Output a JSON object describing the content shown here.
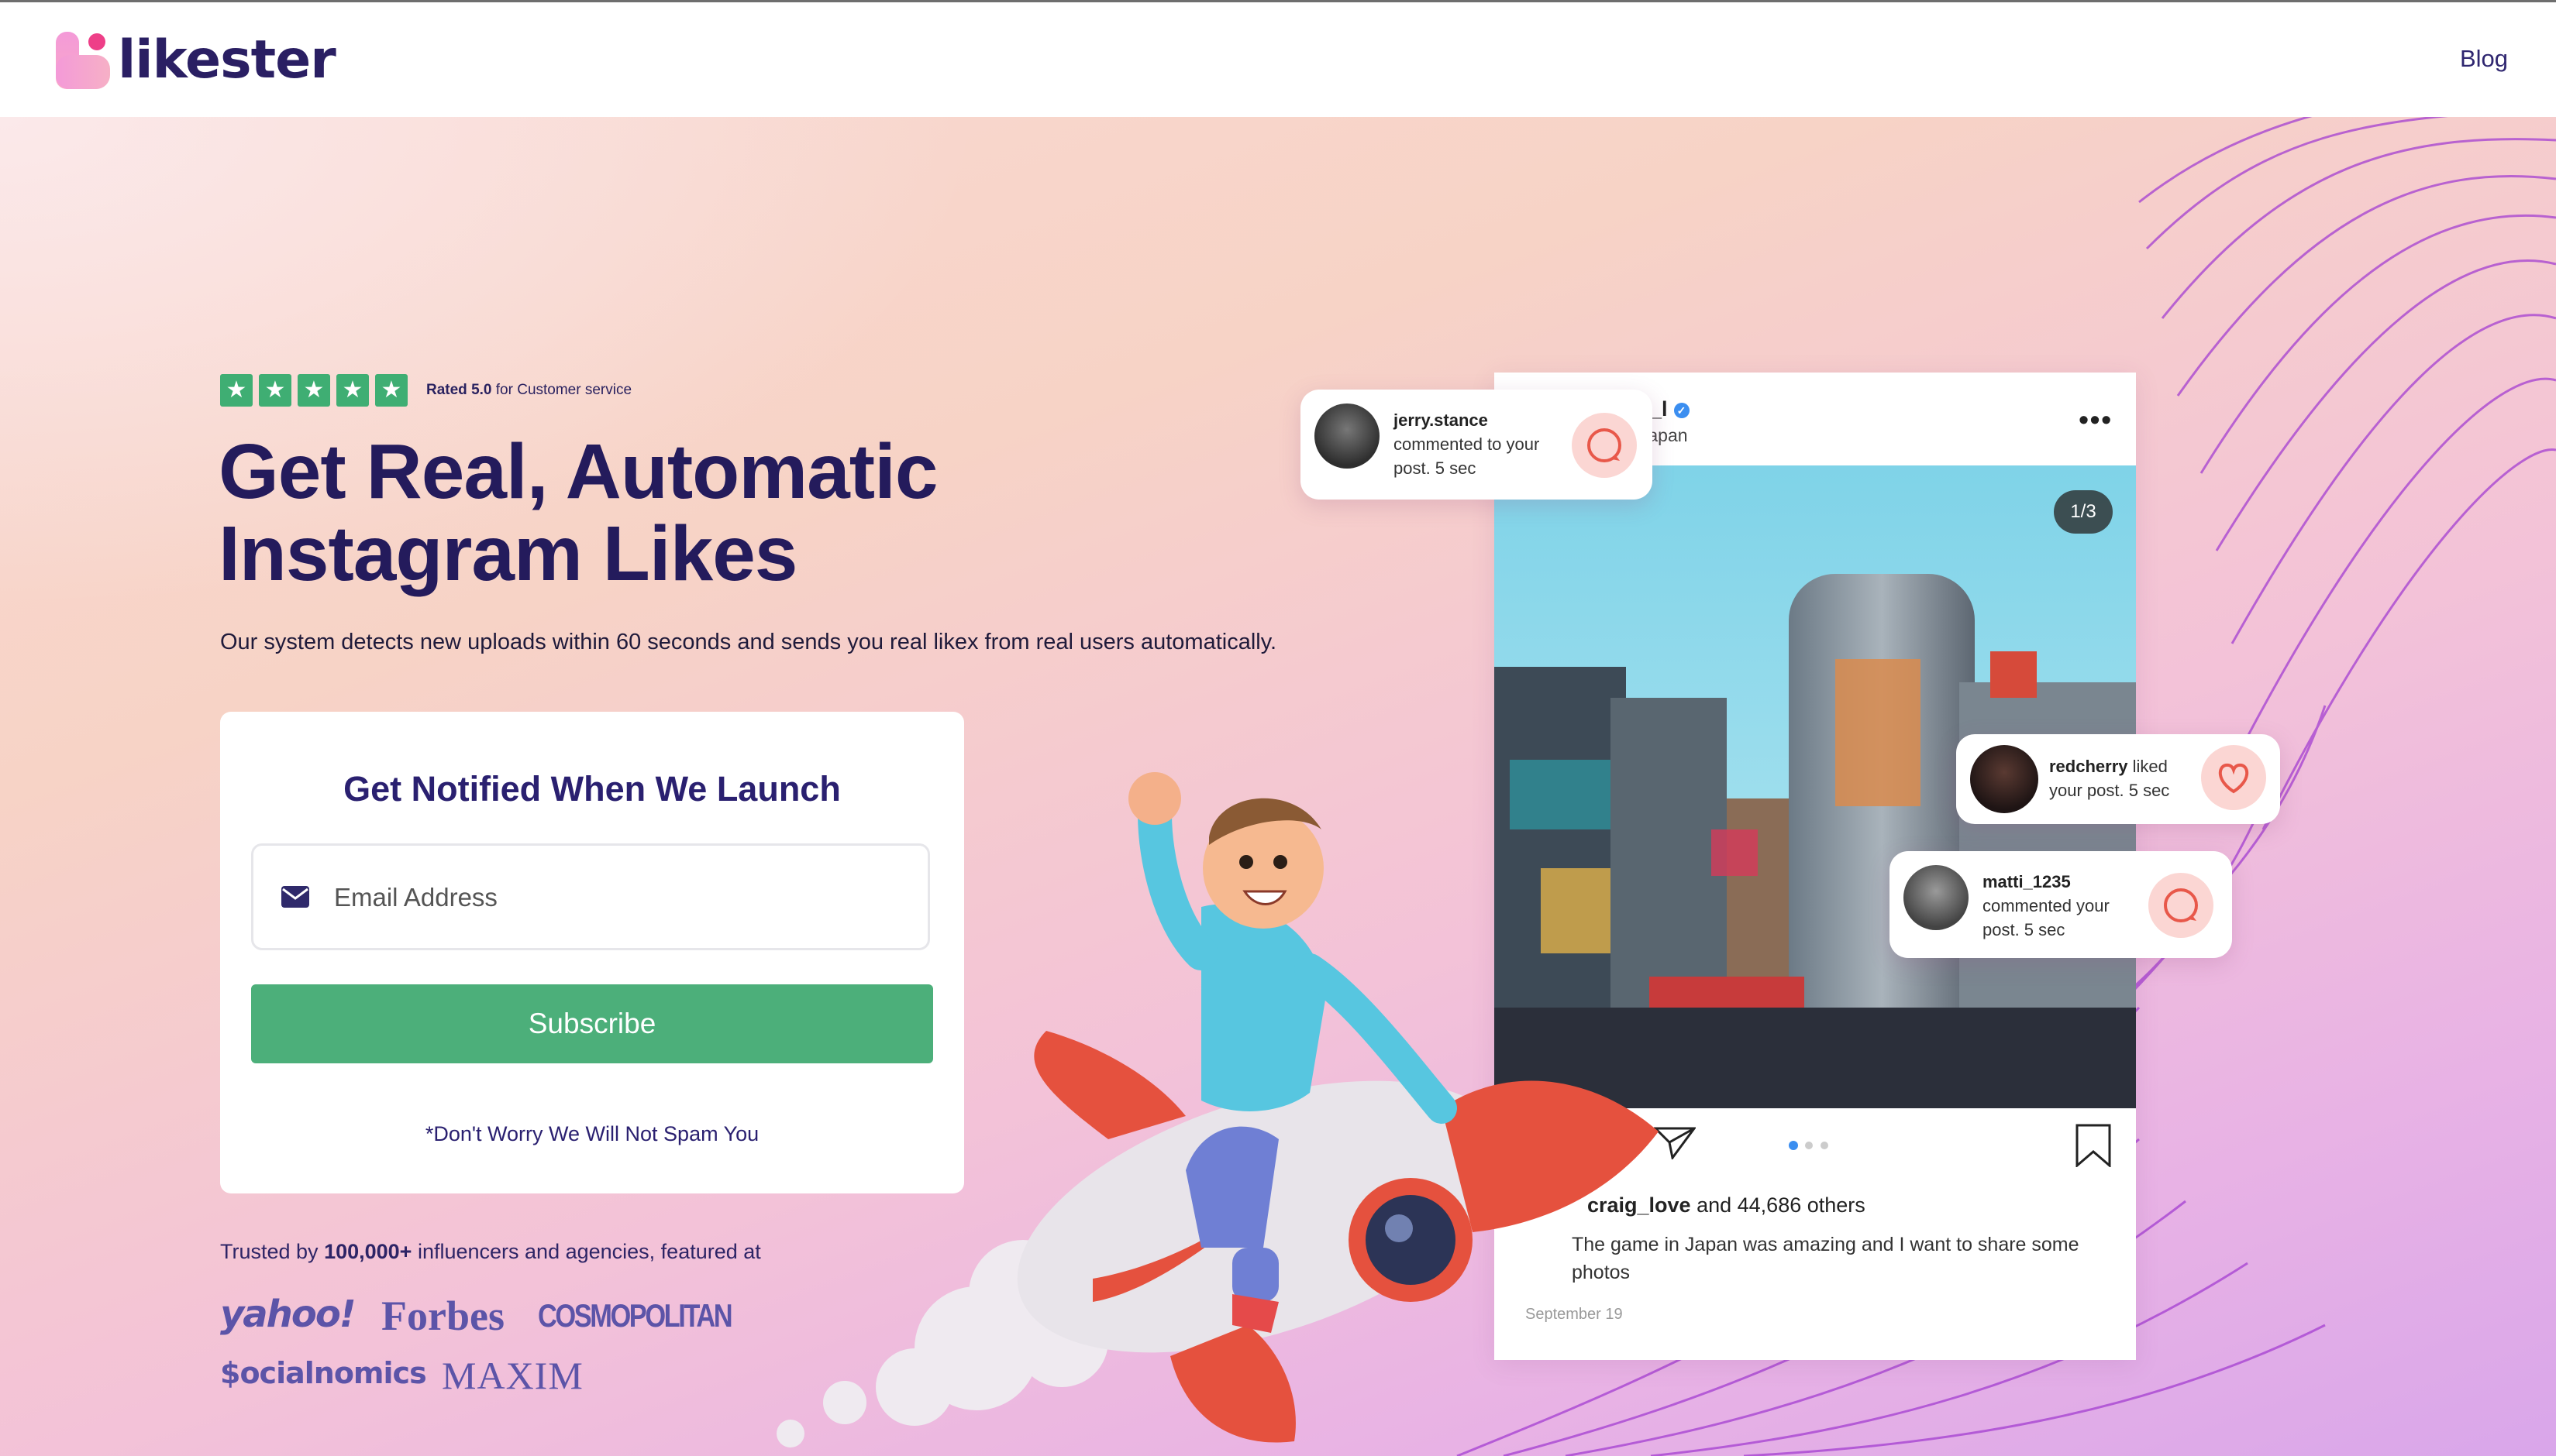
{
  "brand": {
    "name": "likester",
    "accent": "#4caf7a",
    "primary_text": "#241b5c"
  },
  "nav": {
    "blog_label": "Blog"
  },
  "rating": {
    "stars": 5,
    "rated_label": "Rated 5.0",
    "suffix": "for Customer service"
  },
  "hero": {
    "headline_line1": "Get Real, Automatic",
    "headline_line2": "Instagram Likes",
    "subtext": "Our system detects new uploads within 60 seconds and sends you real likex from real users automatically."
  },
  "signup": {
    "title": "Get Notified When We Launch",
    "email_placeholder": "Email Address",
    "email_value": "",
    "subscribe_label": "Subscribe",
    "disclaimer": "*Don't Worry We Will Not Spam You"
  },
  "trust": {
    "prefix": "Trusted by",
    "count": "100,000+",
    "suffix": "influencers and agencies, featured at",
    "press": [
      "yahoo!",
      "Forbes",
      "COSMOPOLITAN",
      "$ocialnomics",
      "MAXIM"
    ]
  },
  "instagram_post": {
    "username": "joshua_l",
    "location": "Tokyo, Japan",
    "counter": "1/3",
    "liked_by": "craig_love",
    "liked_others": "and 44,686 others",
    "caption": "The game in Japan was amazing and I want to share some photos",
    "date": "September 19",
    "carousel_dots": 3,
    "carousel_active": 1
  },
  "notifications": [
    {
      "user": "jerry.stance",
      "text_line1": "commented to your",
      "text_line2": "post. 5 sec",
      "type": "comment"
    },
    {
      "user": "redcherry",
      "text_line1": "liked",
      "text_line2": "your post. 5 sec",
      "type": "like"
    },
    {
      "user": "matti_1235",
      "text_line1": "commented your",
      "text_line2": "post. 5 sec",
      "type": "comment"
    }
  ]
}
